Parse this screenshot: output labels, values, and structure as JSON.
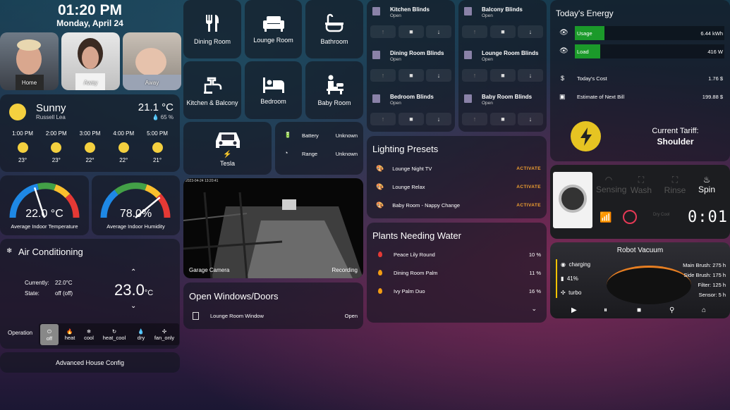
{
  "clock": {
    "time": "01:20 PM",
    "date": "Monday, April 24"
  },
  "people": [
    {
      "label": "Home"
    },
    {
      "label": "Away"
    },
    {
      "label": "Away"
    }
  ],
  "weather": {
    "condition": "Sunny",
    "location": "Russell Lea",
    "temp": "21.1 °C",
    "humidity": "65 %",
    "forecast": [
      {
        "time": "1:00 PM",
        "temp": "23°"
      },
      {
        "time": "2:00 PM",
        "temp": "23°"
      },
      {
        "time": "3:00 PM",
        "temp": "22°"
      },
      {
        "time": "4:00 PM",
        "temp": "22°"
      },
      {
        "time": "5:00 PM",
        "temp": "21°"
      }
    ]
  },
  "gauges": {
    "temp": {
      "value": "22.0 °C",
      "label": "Average Indoor Temperature",
      "level": 0.4
    },
    "humidity": {
      "value": "78.0%",
      "label": "Average Indoor Humidity",
      "level": 0.78
    }
  },
  "ac": {
    "title": "Air Conditioning",
    "currently_label": "Currently:",
    "currently": "22.0°C",
    "state_label": "State:",
    "state": "off (off)",
    "target": "23.0",
    "unit": "°C",
    "operation_label": "Operation",
    "modes": [
      {
        "label": "off"
      },
      {
        "label": "heat"
      },
      {
        "label": "cool"
      },
      {
        "label": "heat_cool"
      },
      {
        "label": "dry"
      },
      {
        "label": "fan_only"
      }
    ]
  },
  "advanced": {
    "label": "Advanced House Config"
  },
  "rooms": [
    {
      "label": "Dining Room"
    },
    {
      "label": "Lounge Room"
    },
    {
      "label": "Bathroom"
    },
    {
      "label": "Kitchen & Balcony"
    },
    {
      "label": "Bedroom"
    },
    {
      "label": "Baby Room"
    }
  ],
  "tesla": {
    "label": "Tesla",
    "battery_label": "Battery",
    "battery": "Unknown",
    "range_label": "Range",
    "range": "Unknown"
  },
  "camera": {
    "label": "Garage Camera",
    "status": "Recording",
    "timestamp": "2023-04-24 13:20:41"
  },
  "windows": {
    "title": "Open Windows/Doors",
    "items": [
      {
        "name": "Lounge Room Window",
        "state": "Open"
      }
    ]
  },
  "blinds": [
    {
      "name": "Kitchen Blinds",
      "state": "Open"
    },
    {
      "name": "Balcony Blinds",
      "state": "Open"
    },
    {
      "name": "Dining Room Blinds",
      "state": "Open"
    },
    {
      "name": "Lounge Room Blinds",
      "state": "Open"
    },
    {
      "name": "Bedroom Blinds",
      "state": "Open"
    },
    {
      "name": "Baby Room Blinds",
      "state": "Open"
    }
  ],
  "lighting": {
    "title": "Lighting Presets",
    "items": [
      {
        "name": "Lounge Night TV",
        "action": "ACTIVATE"
      },
      {
        "name": "Lounge Relax",
        "action": "ACTIVATE"
      },
      {
        "name": "Baby Room - Nappy Change",
        "action": "ACTIVATE"
      }
    ]
  },
  "plants": {
    "title": "Plants Needing Water",
    "items": [
      {
        "name": "Peace Lily Round",
        "value": "10 %",
        "color": "#e53935"
      },
      {
        "name": "Dining Room Palm",
        "value": "11 %",
        "color": "#f39c12"
      },
      {
        "name": "Ivy Palm Duo",
        "value": "16 %",
        "color": "#f39c12"
      }
    ]
  },
  "energy": {
    "title": "Today's Energy",
    "usage_label": "Usage",
    "usage": "6.44 kWh",
    "usage_level": 0.2,
    "load_label": "Load",
    "load": "416 W",
    "load_level": 0.17,
    "cost_label": "Today's Cost",
    "cost": "1.76 $",
    "bill_label": "Estimate of Next Bill",
    "bill": "199.88 $",
    "tariff_label": "Current Tariff:",
    "tariff": "Shoulder"
  },
  "washer": {
    "steps": [
      "Sensing",
      "Wash",
      "Rinse",
      "Spin"
    ],
    "time": "0:01",
    "sub_dry": "Dry",
    "sub_cool": "Cool"
  },
  "robot": {
    "title": "Robot Vacuum",
    "status": "charging",
    "battery": "41%",
    "fan": "turbo",
    "main_brush": "Main Brush: 275 h",
    "side_brush": "Side Brush: 175 h",
    "filter": "Filter: 125 h",
    "sensor": "Sensor: 5 h"
  }
}
